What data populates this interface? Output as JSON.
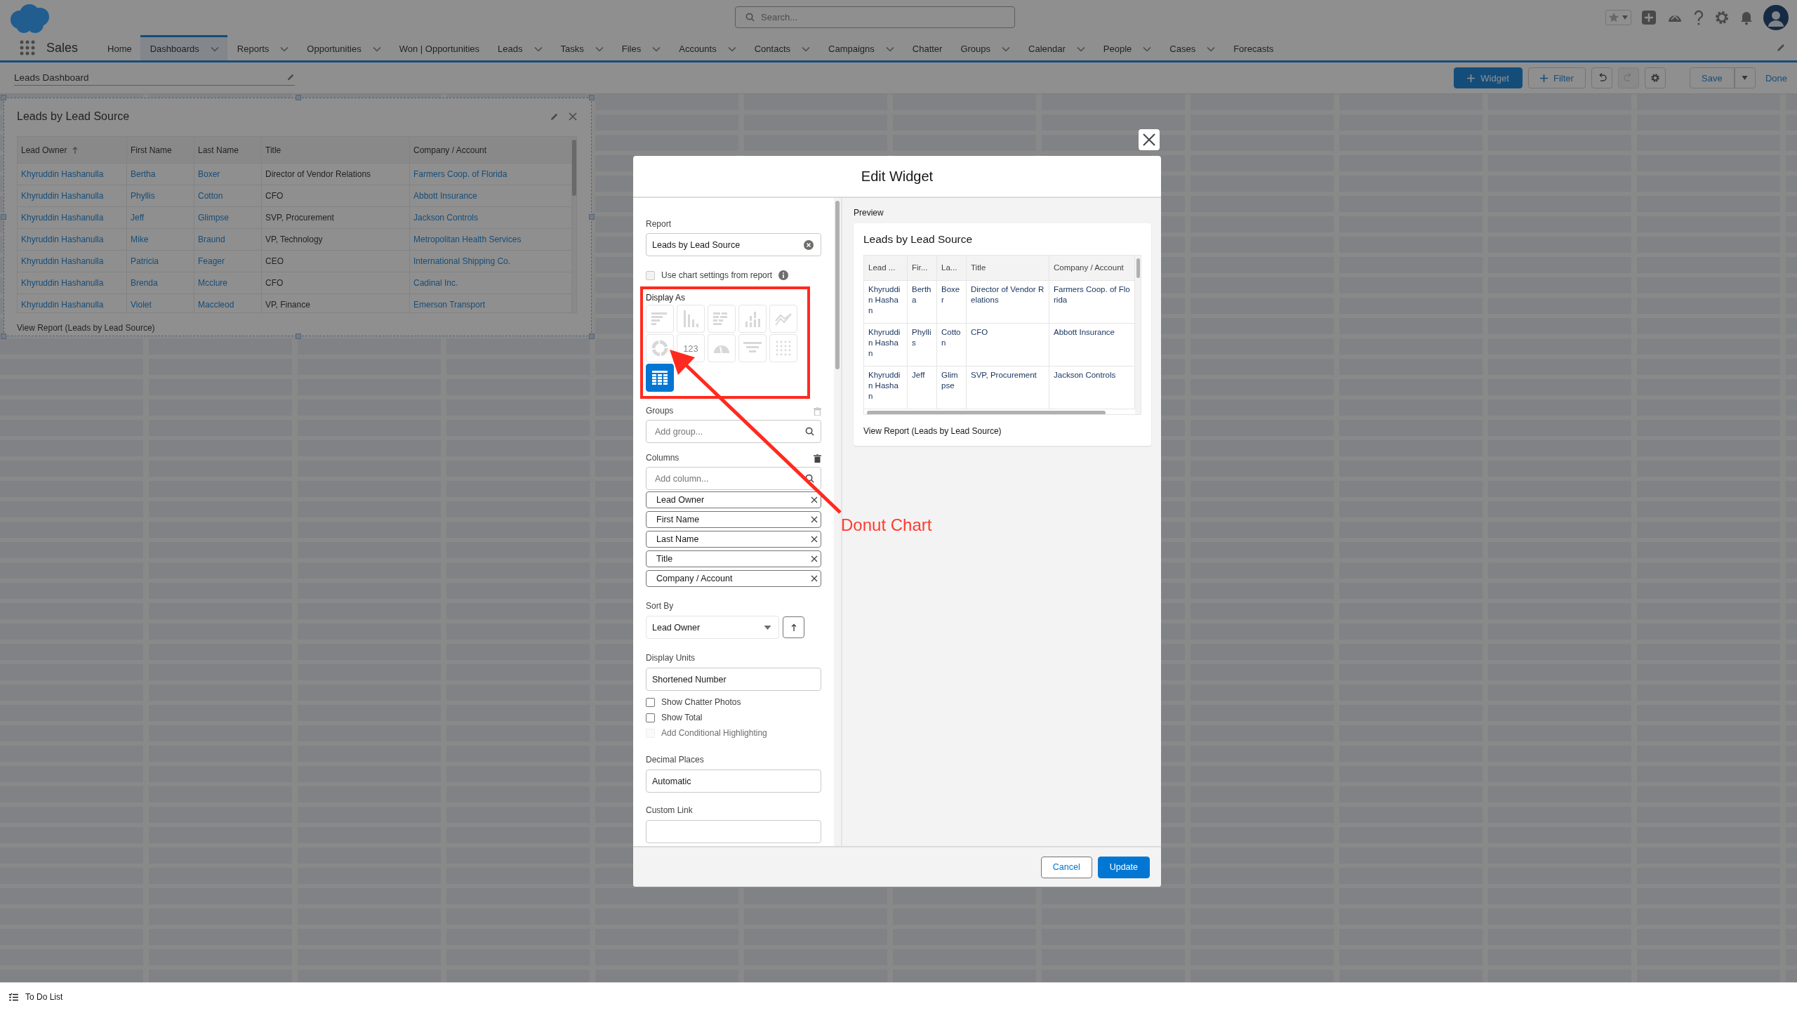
{
  "app": {
    "name": "Sales"
  },
  "search": {
    "placeholder": "Search..."
  },
  "nav": [
    {
      "label": "Home",
      "selected": false,
      "has_menu": false
    },
    {
      "label": "Dashboards",
      "selected": true,
      "has_menu": true
    },
    {
      "label": "Reports",
      "selected": false,
      "has_menu": true
    },
    {
      "label": "Opportunities",
      "selected": false,
      "has_menu": true
    },
    {
      "label": "Won | Opportunities",
      "selected": false,
      "has_menu": false
    },
    {
      "label": "Leads",
      "selected": false,
      "has_menu": true
    },
    {
      "label": "Tasks",
      "selected": false,
      "has_menu": true
    },
    {
      "label": "Files",
      "selected": false,
      "has_menu": true
    },
    {
      "label": "Accounts",
      "selected": false,
      "has_menu": true
    },
    {
      "label": "Contacts",
      "selected": false,
      "has_menu": true
    },
    {
      "label": "Campaigns",
      "selected": false,
      "has_menu": true
    },
    {
      "label": "Chatter",
      "selected": false,
      "has_menu": false
    },
    {
      "label": "Groups",
      "selected": false,
      "has_menu": true
    },
    {
      "label": "Calendar",
      "selected": false,
      "has_menu": true
    },
    {
      "label": "People",
      "selected": false,
      "has_menu": true
    },
    {
      "label": "Cases",
      "selected": false,
      "has_menu": true
    },
    {
      "label": "Forecasts",
      "selected": false,
      "has_menu": false
    }
  ],
  "dashboard": {
    "title": "Leads Dashboard",
    "toolbar": [
      {
        "kind": "primary_add",
        "label": "Widget",
        "disabled": false
      },
      {
        "kind": "add",
        "label": "Filter",
        "disabled": false
      },
      {
        "kind": "undo",
        "disabled": false
      },
      {
        "kind": "redo",
        "disabled": true
      },
      {
        "kind": "settings",
        "disabled": false
      },
      {
        "kind": "save",
        "label": "Save",
        "disabled": false
      },
      {
        "kind": "menu",
        "disabled": false
      },
      {
        "kind": "link",
        "label": "Done",
        "disabled": false
      }
    ]
  },
  "widget": {
    "title": "Leads by Lead Source",
    "columns": [
      {
        "label": "Lead Owner",
        "sorted": true,
        "link": true
      },
      {
        "label": "First Name",
        "sorted": false,
        "link": true
      },
      {
        "label": "Last Name",
        "sorted": false,
        "link": true
      },
      {
        "label": "Title",
        "sorted": false,
        "link": false
      },
      {
        "label": "Company / Account",
        "sorted": false,
        "link": true
      }
    ],
    "rows": [
      [
        "Khyruddin Hashanulla",
        "Bertha",
        "Boxer",
        "Director of Vendor Relations",
        "Farmers Coop. of Florida"
      ],
      [
        "Khyruddin Hashanulla",
        "Phyllis",
        "Cotton",
        "CFO",
        "Abbott Insurance"
      ],
      [
        "Khyruddin Hashanulla",
        "Jeff",
        "Glimpse",
        "SVP, Procurement",
        "Jackson Controls"
      ],
      [
        "Khyruddin Hashanulla",
        "Mike",
        "Braund",
        "VP, Technology",
        "Metropolitan Health Services"
      ],
      [
        "Khyruddin Hashanulla",
        "Patricia",
        "Feager",
        "CEO",
        "International Shipping Co."
      ],
      [
        "Khyruddin Hashanulla",
        "Brenda",
        "Mcclure",
        "CFO",
        "Cadinal Inc."
      ],
      [
        "Khyruddin Hashanulla",
        "Violet",
        "Maccleod",
        "VP, Finance",
        "Emerson Transport"
      ]
    ],
    "link": "View Report (Leads by Lead Source)"
  },
  "modal": {
    "title": "Edit Widget",
    "report": {
      "label": "Report",
      "value": "Leads by Lead Source"
    },
    "use_chart_settings": {
      "label": "Use chart settings from report",
      "checked": false
    },
    "display_as": {
      "label": "Display As",
      "options": [
        {
          "kind": "bar_h",
          "selected": false,
          "disabled": true
        },
        {
          "kind": "bar_v",
          "selected": false,
          "disabled": true
        },
        {
          "kind": "stacked_h",
          "selected": false,
          "disabled": true
        },
        {
          "kind": "stacked_v",
          "selected": false,
          "disabled": true
        },
        {
          "kind": "line",
          "selected": false,
          "disabled": true
        },
        {
          "kind": "donut",
          "selected": false,
          "disabled": true
        },
        {
          "kind": "metric",
          "text": "123",
          "selected": false,
          "disabled": true
        },
        {
          "kind": "gauge",
          "selected": false,
          "disabled": true
        },
        {
          "kind": "funnel",
          "selected": false,
          "disabled": true
        },
        {
          "kind": "scatter",
          "selected": false,
          "disabled": true
        },
        {
          "kind": "table",
          "selected": true,
          "disabled": false
        }
      ]
    },
    "groups": {
      "label": "Groups",
      "placeholder": "Add group..."
    },
    "columns": {
      "label": "Columns",
      "placeholder": "Add column...",
      "items": [
        "Lead Owner",
        "First Name",
        "Last Name",
        "Title",
        "Company / Account"
      ]
    },
    "sort_by": {
      "label": "Sort By",
      "value": "Lead Owner",
      "ascending": true
    },
    "display_units": {
      "label": "Display Units",
      "value": "Shortened Number"
    },
    "options": [
      {
        "label": "Show Chatter Photos",
        "checked": false,
        "disabled": false
      },
      {
        "label": "Show Total",
        "checked": false,
        "disabled": false
      },
      {
        "label": "Add Conditional Highlighting",
        "checked": false,
        "disabled": true
      }
    ],
    "decimal_places": {
      "label": "Decimal Places",
      "value": "Automatic"
    },
    "custom_link": {
      "label": "Custom Link"
    },
    "preview": {
      "label": "Preview",
      "title": "Leads by Lead Source",
      "columns": [
        "Lead ...",
        "Fir...",
        "La...",
        "Title",
        "Company / Account"
      ],
      "rows": [
        [
          "Khyruddin Hashan",
          "Bertha",
          "Boxer",
          "Director of Vendor Relations",
          "Farmers Coop. of Florida"
        ],
        [
          "Khyruddin Hashan",
          "Phyllis",
          "Cotton",
          "CFO",
          "Abbott Insurance"
        ],
        [
          "Khyruddin Hashan",
          "Jeff",
          "Glimpse",
          "SVP, Procurement",
          "Jackson Controls"
        ]
      ],
      "link": "View Report (Leads by Lead Source)"
    },
    "buttons": [
      {
        "kind": "neutral",
        "label": "Cancel"
      },
      {
        "kind": "brand",
        "label": "Update"
      }
    ]
  },
  "annotation": {
    "label": "Donut Chart"
  },
  "utility_bar": {
    "label": "To Do List"
  }
}
